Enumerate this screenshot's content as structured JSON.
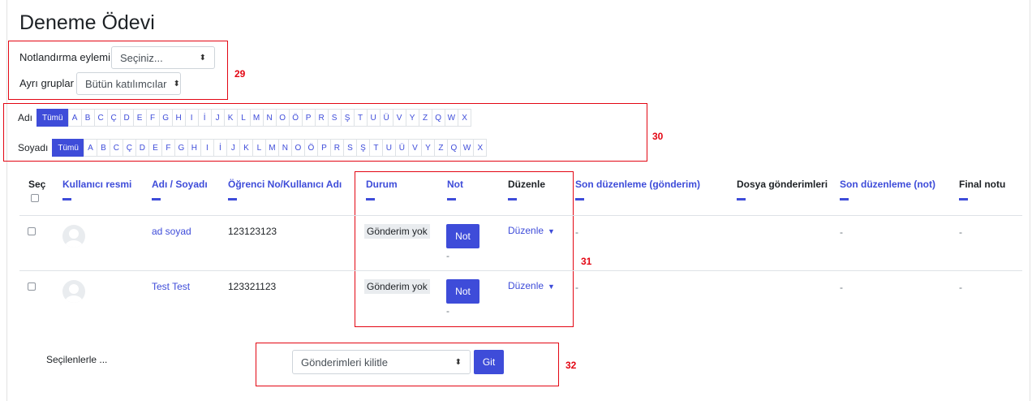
{
  "page": {
    "title": "Deneme Ödevi"
  },
  "controls": {
    "grading_action_label": "Notlandırma eylemi",
    "grading_action_value": "Seçiniz...",
    "groups_label": "Ayrı gruplar",
    "groups_value": "Bütün katılımcılar"
  },
  "annotations": [
    "29",
    "30",
    "31",
    "32"
  ],
  "initials": {
    "first_label": "Adı",
    "last_label": "Soyadı",
    "all": "Tümü",
    "letters": [
      "A",
      "B",
      "C",
      "Ç",
      "D",
      "E",
      "F",
      "G",
      "H",
      "I",
      "İ",
      "J",
      "K",
      "L",
      "M",
      "N",
      "O",
      "Ö",
      "P",
      "R",
      "S",
      "Ş",
      "T",
      "U",
      "Ü",
      "V",
      "Y",
      "Z",
      "Q",
      "W",
      "X"
    ]
  },
  "table": {
    "headers": {
      "select": "Seç",
      "picture": "Kullanıcı resmi",
      "name": "Adı / Soyadı",
      "idnumber": "Öğrenci No/Kullanıcı Adı",
      "status": "Durum",
      "grade": "Not",
      "edit": "Düzenle",
      "last_modified_submission": "Son düzenleme (gönderim)",
      "file_submissions": "Dosya gönderimleri",
      "last_modified_grade": "Son düzenleme (not)",
      "final_grade": "Final notu"
    },
    "rows": [
      {
        "name": "ad soyad",
        "idnumber": "123123123",
        "status": "Gönderim yok",
        "grade_button": "Not",
        "grade_value": "-",
        "edit": "Düzenle",
        "last_modified_submission": "-",
        "last_modified_grade": "-",
        "final_grade": "-"
      },
      {
        "name": "Test Test",
        "idnumber": "123321123",
        "status": "Gönderim yok",
        "grade_button": "Not",
        "grade_value": "-",
        "edit": "Düzenle",
        "last_modified_submission": "-",
        "last_modified_grade": "-",
        "final_grade": "-"
      }
    ]
  },
  "bulk": {
    "label": "Seçilenlerle ...",
    "select_value": "Gönderimleri kilitle",
    "go_button": "Git"
  },
  "colors": {
    "accent": "#3e4cd9",
    "annotation": "#e30613"
  }
}
